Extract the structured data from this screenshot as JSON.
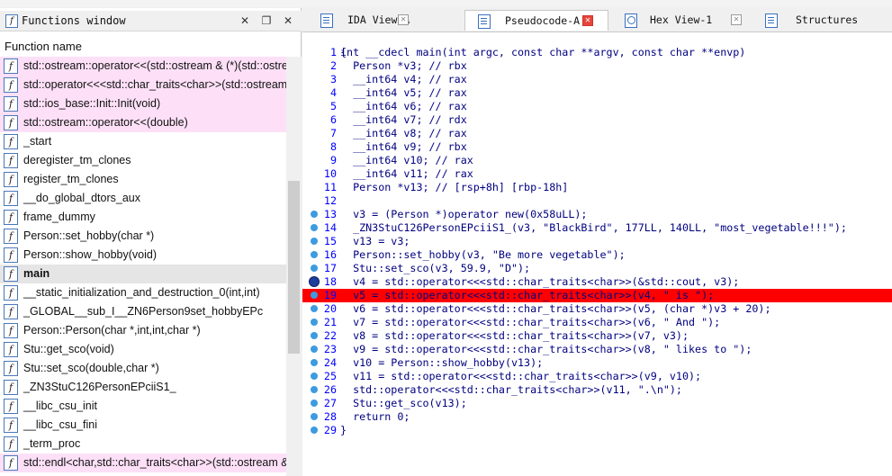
{
  "functions_window": {
    "title": "Functions window",
    "column_header": "Function name",
    "items": [
      {
        "name": "std::ostream::operator<<(std::ostream & (*)(std::ostream &))",
        "style": "pink"
      },
      {
        "name": "std::operator<<<std::char_traits<char>>(std::ostream &,char const*)",
        "style": "pink"
      },
      {
        "name": "std::ios_base::Init::Init(void)",
        "style": "pink"
      },
      {
        "name": "std::ostream::operator<<(double)",
        "style": "pink"
      },
      {
        "name": "_start",
        "style": ""
      },
      {
        "name": "deregister_tm_clones",
        "style": ""
      },
      {
        "name": "register_tm_clones",
        "style": ""
      },
      {
        "name": "__do_global_dtors_aux",
        "style": ""
      },
      {
        "name": "frame_dummy",
        "style": ""
      },
      {
        "name": "Person::set_hobby(char *)",
        "style": ""
      },
      {
        "name": "Person::show_hobby(void)",
        "style": ""
      },
      {
        "name": "main",
        "style": "sel"
      },
      {
        "name": "__static_initialization_and_destruction_0(int,int)",
        "style": ""
      },
      {
        "name": "_GLOBAL__sub_I__ZN6Person9set_hobbyEPc",
        "style": ""
      },
      {
        "name": "Person::Person(char *,int,int,char *)",
        "style": ""
      },
      {
        "name": "Stu::get_sco(void)",
        "style": ""
      },
      {
        "name": "Stu::set_sco(double,char *)",
        "style": ""
      },
      {
        "name": "_ZN3StuC126PersonEPciiS1_",
        "style": ""
      },
      {
        "name": "__libc_csu_init",
        "style": ""
      },
      {
        "name": "__libc_csu_fini",
        "style": ""
      },
      {
        "name": "_term_proc",
        "style": ""
      },
      {
        "name": "std::endl<char,std::char_traits<char>>(std::ostream &)",
        "style": "pink"
      }
    ]
  },
  "tabs": [
    {
      "label": "IDA View-A",
      "icon": "ida-view-icon",
      "active": false
    },
    {
      "label": "Pseudocode-A",
      "icon": "pseudocode-icon",
      "active": true
    },
    {
      "label": "Hex View-1",
      "icon": "hex-view-icon",
      "active": false
    },
    {
      "label": "Structures",
      "icon": "structures-icon",
      "active": false
    }
  ],
  "code": {
    "header": "int __cdecl main(int argc, const char **argv, const char **envp)",
    "lines": [
      {
        "n": "1",
        "t": "{",
        "mark": ""
      },
      {
        "n": "2",
        "t": "  Person *v3; // rbx",
        "mark": ""
      },
      {
        "n": "3",
        "t": "  __int64 v4; // rax",
        "mark": ""
      },
      {
        "n": "4",
        "t": "  __int64 v5; // rax",
        "mark": ""
      },
      {
        "n": "5",
        "t": "  __int64 v6; // rax",
        "mark": ""
      },
      {
        "n": "6",
        "t": "  __int64 v7; // rdx",
        "mark": ""
      },
      {
        "n": "7",
        "t": "  __int64 v8; // rax",
        "mark": ""
      },
      {
        "n": "8",
        "t": "  __int64 v9; // rbx",
        "mark": ""
      },
      {
        "n": "9",
        "t": "  __int64 v10; // rax",
        "mark": ""
      },
      {
        "n": "10",
        "t": "  __int64 v11; // rax",
        "mark": ""
      },
      {
        "n": "11",
        "t": "  Person *v13; // [rsp+8h] [rbp-18h]",
        "mark": ""
      },
      {
        "n": "12",
        "t": "",
        "mark": ""
      },
      {
        "n": "13",
        "t": "  v3 = (Person *)operator new(0x58uLL);",
        "mark": "dot"
      },
      {
        "n": "14",
        "t": "  _ZN3StuC126PersonEPciiS1_(v3, \"BlackBird\", 177LL, 140LL, \"most_vegetable!!!\");",
        "mark": "dot"
      },
      {
        "n": "15",
        "t": "  v13 = v3;",
        "mark": "dot"
      },
      {
        "n": "16",
        "t": "  Person::set_hobby(v3, \"Be more vegetable\");",
        "mark": "dot"
      },
      {
        "n": "17",
        "t": "  Stu::set_sco(v3, 59.9, \"D\");",
        "mark": "dot"
      },
      {
        "n": "18",
        "t": "  v4 = std::operator<<<std::char_traits<char>>(&std::cout, v3);",
        "mark": "bp"
      },
      {
        "n": "19",
        "t": "  v5 = std::operator<<<std::char_traits<char>>(v4, \" is \");",
        "mark": "dot"
      },
      {
        "n": "20",
        "t": "  v6 = std::operator<<<std::char_traits<char>>(v5, (char *)v3 + 20);",
        "mark": "dot"
      },
      {
        "n": "21",
        "t": "  v7 = std::operator<<<std::char_traits<char>>(v6, \" And \");",
        "mark": "dot"
      },
      {
        "n": "22",
        "t": "  v8 = std::operator<<<std::char_traits<char>>(v7, v3);",
        "mark": "dot"
      },
      {
        "n": "23",
        "t": "  v9 = std::operator<<<std::char_traits<char>>(v8, \" likes to \");",
        "mark": "dot"
      },
      {
        "n": "24",
        "t": "  v10 = Person::show_hobby(v13);",
        "mark": "dot"
      },
      {
        "n": "25",
        "t": "  v11 = std::operator<<<std::char_traits<char>>(v9, v10);",
        "mark": "dot"
      },
      {
        "n": "26",
        "t": "  std::operator<<<std::char_traits<char>>(v11, \".\\n\");",
        "mark": "dot"
      },
      {
        "n": "27",
        "t": "  Stu::get_sco(v13);",
        "mark": "dot"
      },
      {
        "n": "28",
        "t": "  return 0;",
        "mark": "dot"
      },
      {
        "n": "29",
        "t": "}",
        "mark": "dot"
      }
    ],
    "highlighted_line": "19"
  },
  "colors": {
    "pink_row": "#fde0f7",
    "selected_row": "#e5e5e5",
    "line_numbers": "#0000ff",
    "code_text": "#000080",
    "breakpoint_line": "#ff0000",
    "bp_dot": "#3d9be0"
  }
}
